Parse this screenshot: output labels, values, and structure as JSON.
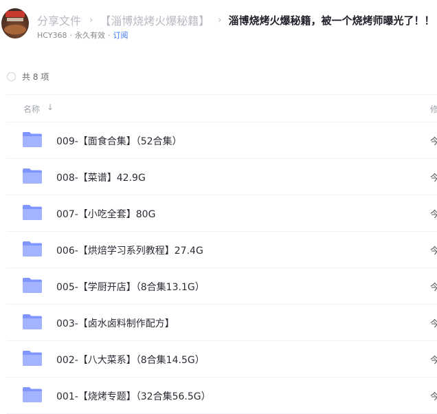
{
  "breadcrumb": {
    "root": "分享文件",
    "parent": "【淄博烧烤火爆秘籍】",
    "current": "淄博烧烤火爆秘籍，被一个烧烤师曝光了！！"
  },
  "meta": {
    "user": "HCY368",
    "validity": "永久有效",
    "subscribe": "订阅"
  },
  "count_label": "共 8 项",
  "table": {
    "header_name": "名称",
    "header_modified": "修",
    "sort_icon": "arrow-down",
    "rows": [
      {
        "name": "009-【面食合集】（52合集）",
        "date": "今"
      },
      {
        "name": "008-【菜谱】42.9G",
        "date": "今"
      },
      {
        "name": "007-【小吃全套】80G",
        "date": "今"
      },
      {
        "name": "006-【烘焙学习系列教程】27.4G",
        "date": "今"
      },
      {
        "name": "005-【学厨开店】（8合集13.1G）",
        "date": "今"
      },
      {
        "name": "003-【卤水卤料制作配方】",
        "date": "今"
      },
      {
        "name": "002-【八大菜系】（8合集14.5G）",
        "date": "今"
      },
      {
        "name": "001-【烧烤专题】（32合集56.5G）",
        "date": "今"
      }
    ]
  },
  "colors": {
    "folder": "#8fa3ff",
    "link": "#3a74f0"
  }
}
